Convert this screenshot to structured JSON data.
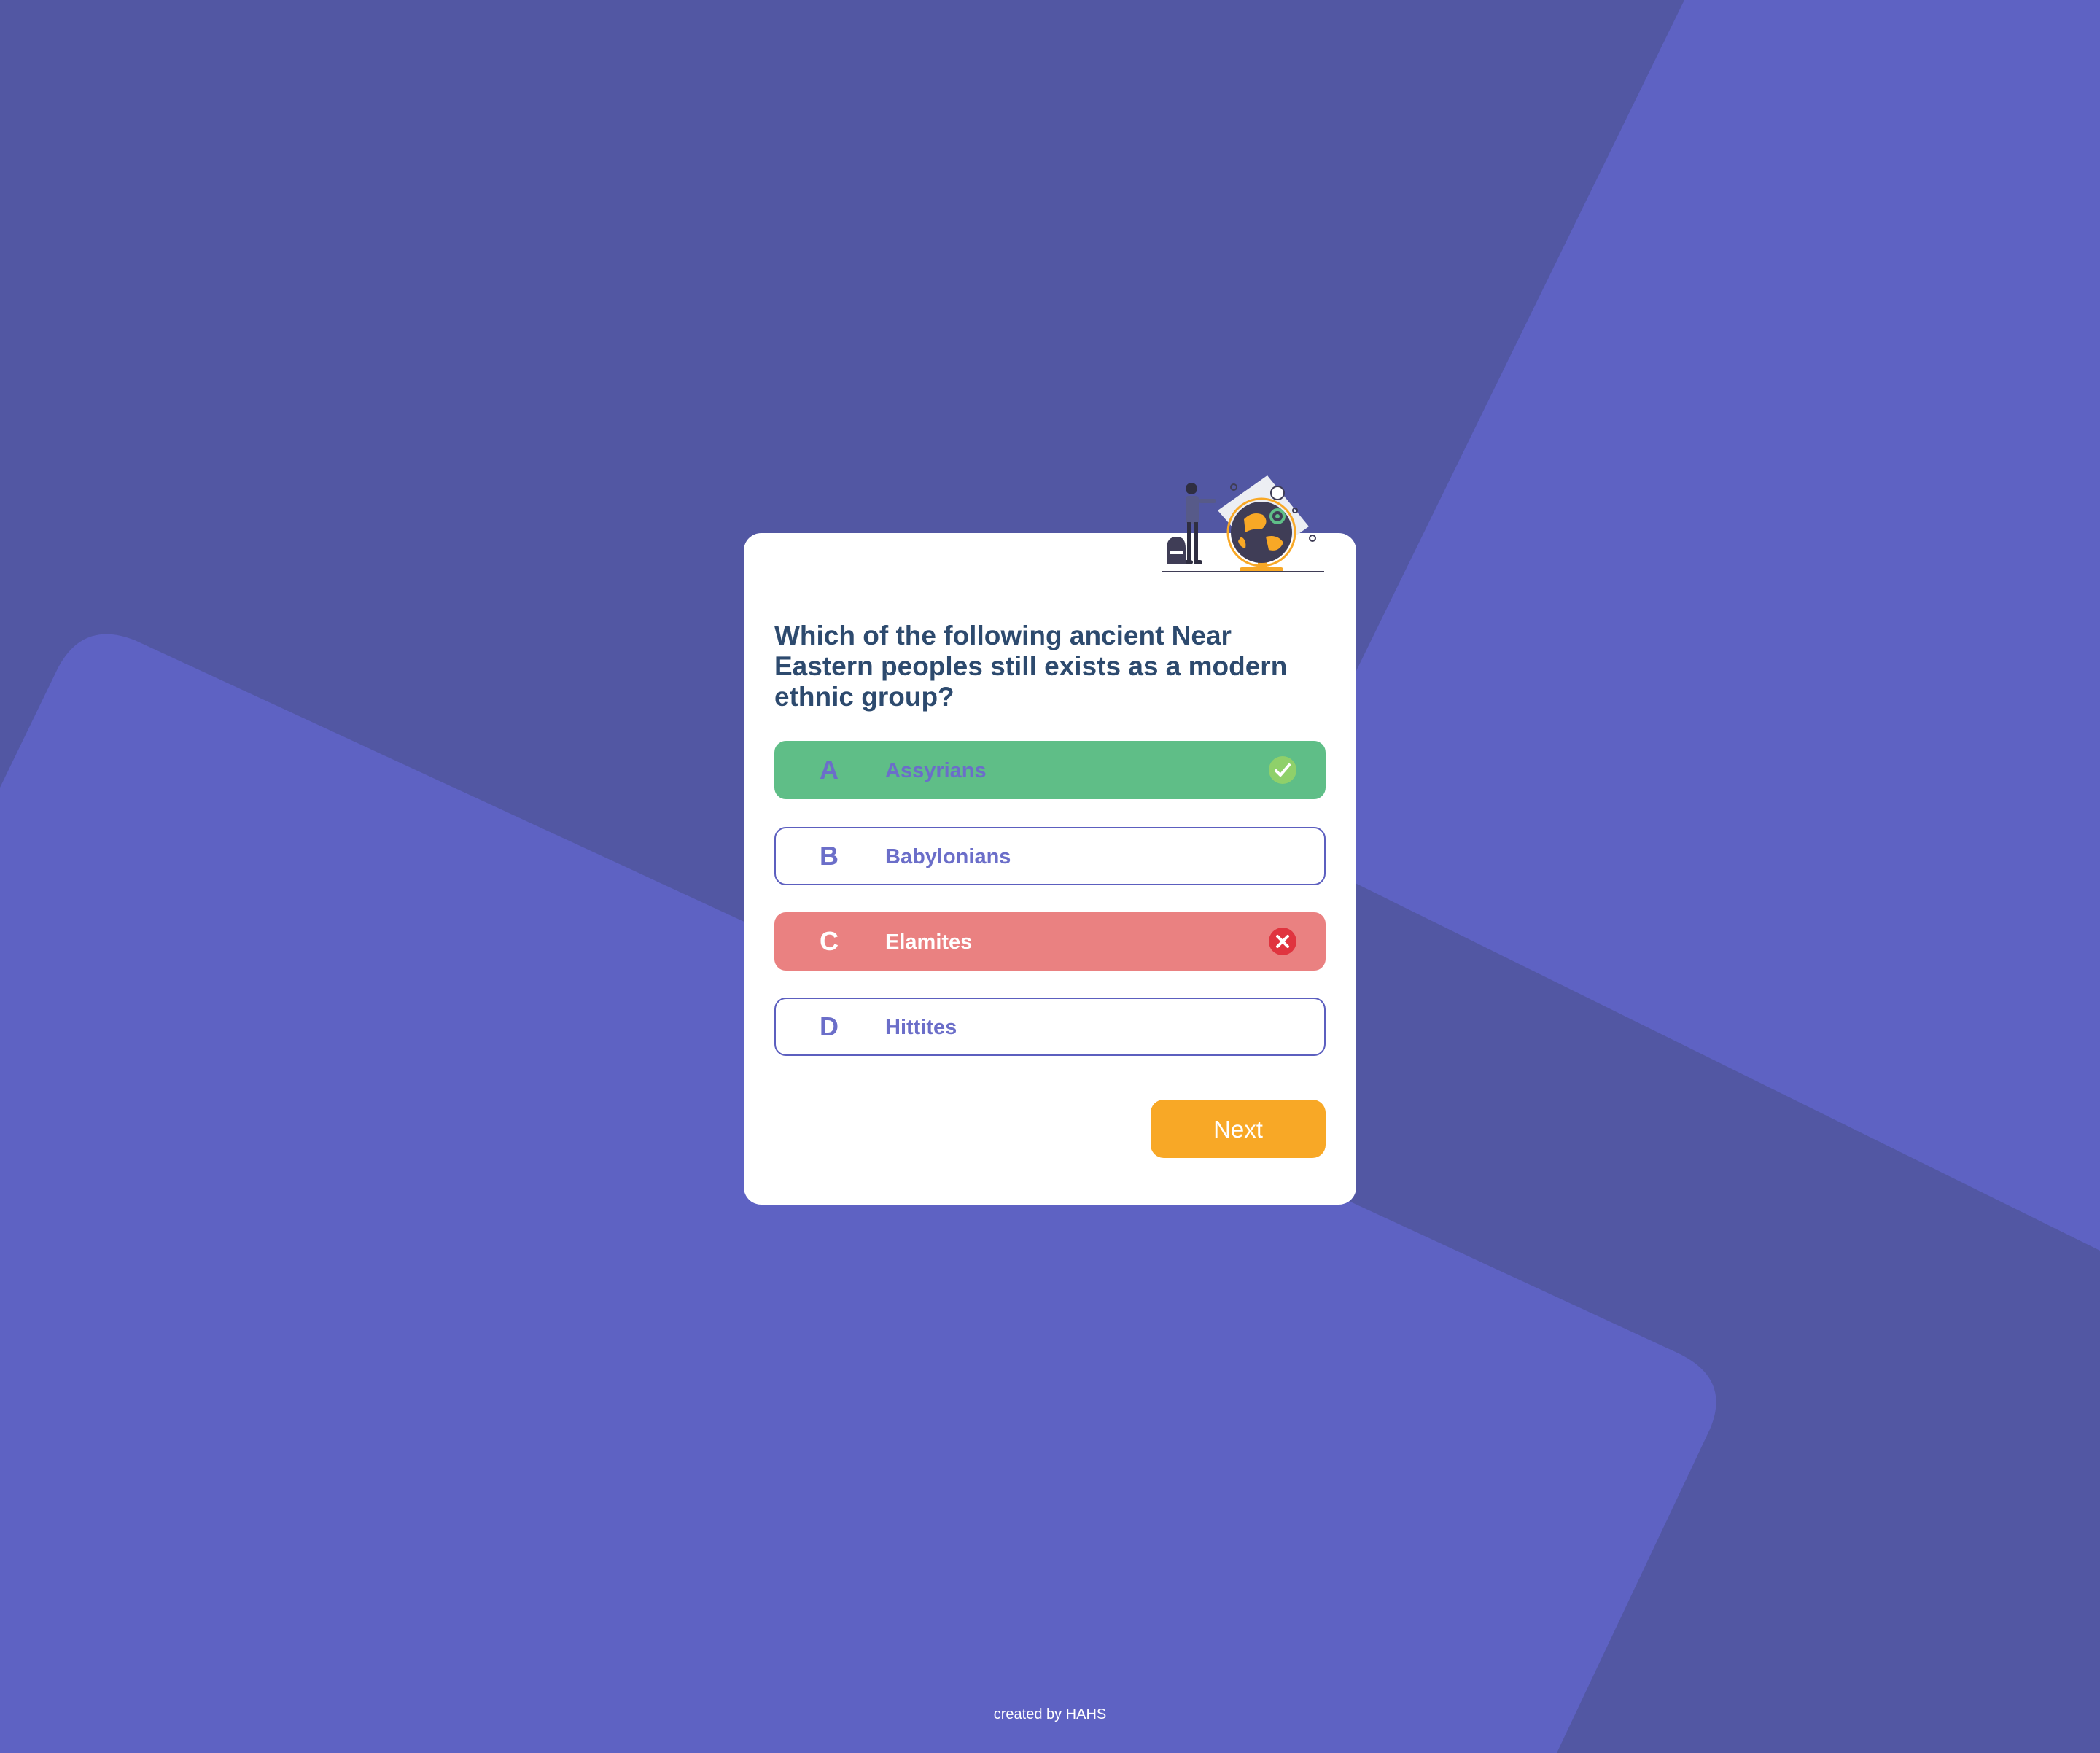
{
  "quiz": {
    "question": "Which of the following ancient Near Eastern peoples still exists as a modern ethnic group?",
    "options": [
      {
        "letter": "A",
        "text": "Assyrians",
        "state": "correct"
      },
      {
        "letter": "B",
        "text": "Babylonians",
        "state": "default"
      },
      {
        "letter": "C",
        "text": "Elamites",
        "state": "wrong"
      },
      {
        "letter": "D",
        "text": "Hittites",
        "state": "default"
      }
    ],
    "next_label": "Next"
  },
  "footer": {
    "credit": "created by HAHS"
  },
  "icons": {
    "correct": "check-circle-icon",
    "wrong": "x-circle-icon",
    "illustration": "traveler-globe-illustration"
  },
  "colors": {
    "background": "#5257a3",
    "shape": "#5e62c3",
    "correct": "#5fbe87",
    "wrong": "#ea8181",
    "accent": "#f8a826",
    "question_text": "#2d4a6e",
    "option_text": "#6b6ec9"
  }
}
